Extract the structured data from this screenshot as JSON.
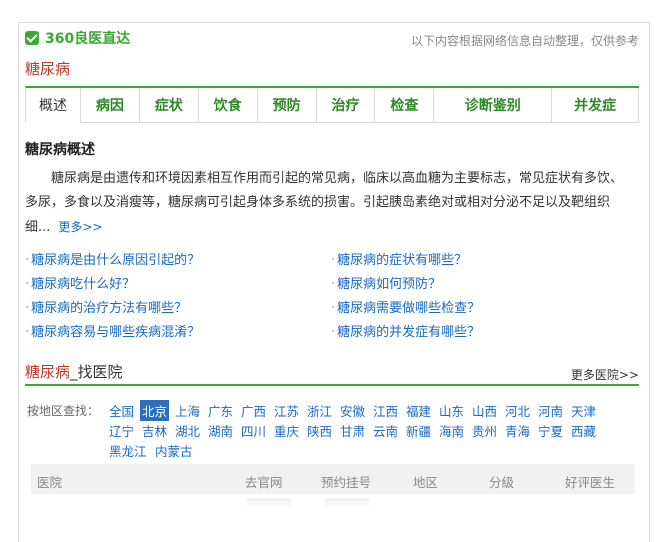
{
  "header": {
    "brand": "360良医直达",
    "disclaimer": "以下内容根据网络信息自动整理，仅供参考"
  },
  "disease": "糖尿病",
  "tabs": [
    "概述",
    "病因",
    "症状",
    "饮食",
    "预防",
    "治疗",
    "检查",
    "诊断鉴别",
    "并发症"
  ],
  "overview": {
    "title": "糖尿病概述",
    "text": "糖尿病是由遗传和环境因素相互作用而引起的常见病，临床以高血糖为主要标志，常见症状有多饮、多尿，多食以及消瘦等，糖尿病可引起身体多系统的损害。引起胰岛素绝对或相对分泌不足以及靶组织细...",
    "more": "更多>>"
  },
  "faq": [
    "糖尿病是由什么原因引起的？",
    "糖尿病的症状有哪些？",
    "糖尿病吃什么好？",
    "糖尿病如何预防？",
    "糖尿病的治疗方法有哪些？",
    "糖尿病需要做哪些检查？",
    "糖尿病容易与哪些疾病混淆？",
    "糖尿病的并发症有哪些？"
  ],
  "hospital": {
    "title_disease": "糖尿病",
    "title_suffix": "_找医院",
    "more": "更多医院>>",
    "region_label": "按地区查找：",
    "regions": [
      "全国",
      "北京",
      "上海",
      "广东",
      "广西",
      "江苏",
      "浙江",
      "安徽",
      "江西",
      "福建",
      "山东",
      "山西",
      "河北",
      "河南",
      "天津",
      "辽宁",
      "吉林",
      "湖北",
      "湖南",
      "四川",
      "重庆",
      "陕西",
      "甘肃",
      "云南",
      "新疆",
      "海南",
      "贵州",
      "青海",
      "宁夏",
      "西藏",
      "黑龙江",
      "内蒙古"
    ],
    "selected_region": "北京",
    "columns": [
      "医院",
      "去官网",
      "预约挂号",
      "地区",
      "分级",
      "好评医生"
    ]
  }
}
